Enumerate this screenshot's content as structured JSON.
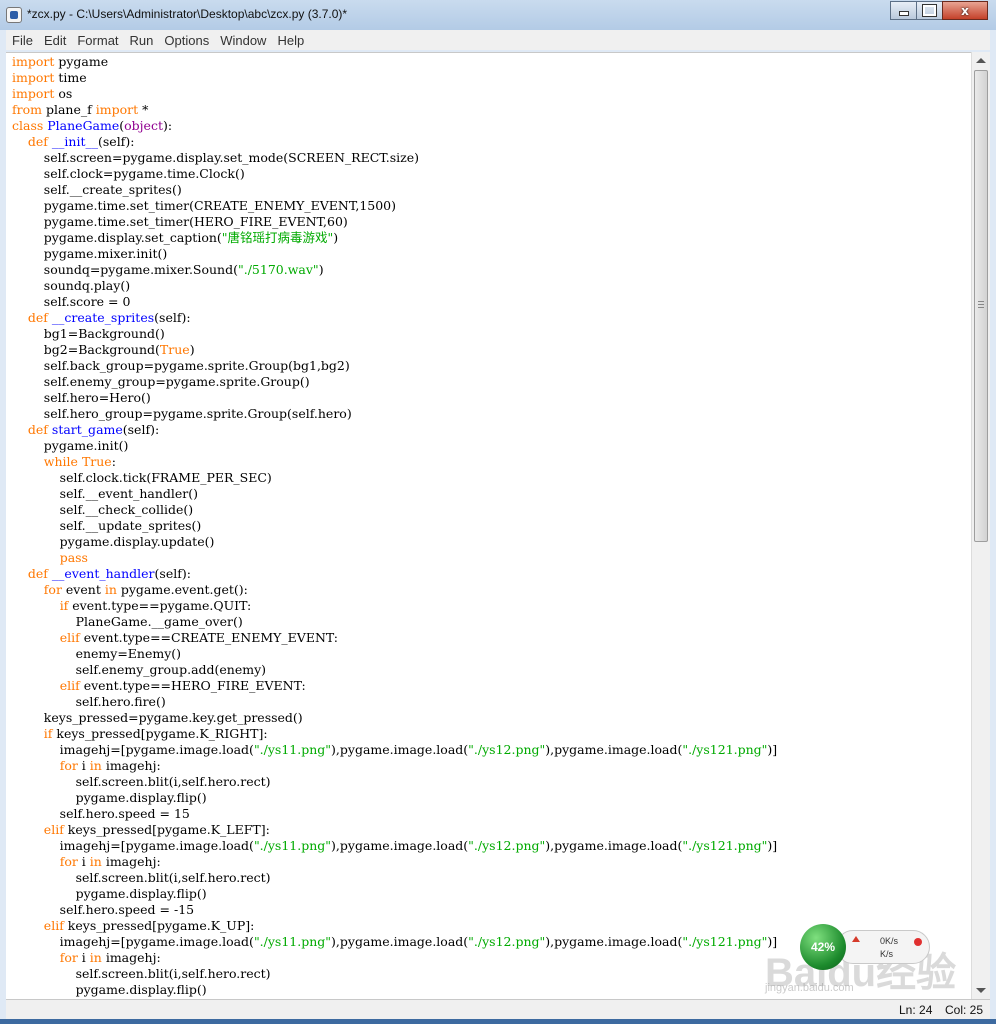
{
  "window": {
    "title": "*zcx.py - C:\\Users\\Administrator\\Desktop\\abc\\zcx.py (3.7.0)*",
    "controls": {
      "minimize": "minimize",
      "maximize": "maximize",
      "close": "x"
    }
  },
  "menu": [
    "File",
    "Edit",
    "Format",
    "Run",
    "Options",
    "Window",
    "Help"
  ],
  "code_lines": [
    [
      [
        "k",
        "import"
      ],
      [
        "n",
        " pygame"
      ]
    ],
    [
      [
        "k",
        "import"
      ],
      [
        "n",
        " time"
      ]
    ],
    [
      [
        "k",
        "import"
      ],
      [
        "n",
        " os"
      ]
    ],
    [
      [
        "k",
        "from"
      ],
      [
        "n",
        " plane_f "
      ],
      [
        "k",
        "import"
      ],
      [
        "n",
        " *"
      ]
    ],
    [
      [
        "k",
        "class"
      ],
      [
        "n",
        " "
      ],
      [
        "d",
        "PlaneGame"
      ],
      [
        "n",
        "("
      ],
      [
        "b",
        "object"
      ],
      [
        "n",
        "):"
      ]
    ],
    [
      [
        "n",
        "    "
      ],
      [
        "k",
        "def"
      ],
      [
        "n",
        " "
      ],
      [
        "d",
        "__init__"
      ],
      [
        "n",
        "(self):"
      ]
    ],
    [
      [
        "n",
        "        self.screen=pygame.display.set_mode(SCREEN_RECT.size)"
      ]
    ],
    [
      [
        "n",
        "        self.clock=pygame.time.Clock()"
      ]
    ],
    [
      [
        "n",
        "        self.__create_sprites()"
      ]
    ],
    [
      [
        "n",
        "        pygame.time.set_timer(CREATE_ENEMY_EVENT,1500)"
      ]
    ],
    [
      [
        "n",
        "        pygame.time.set_timer(HERO_FIRE_EVENT,60)"
      ]
    ],
    [
      [
        "n",
        "        pygame.display.set_caption("
      ],
      [
        "s",
        "\"唐铭瑶打病毒游戏\""
      ],
      [
        "n",
        ")"
      ]
    ],
    [
      [
        "n",
        "        pygame.mixer.init()"
      ]
    ],
    [
      [
        "n",
        "        soundq=pygame.mixer.Sound("
      ],
      [
        "s",
        "\"./5170.wav\""
      ],
      [
        "n",
        ")"
      ]
    ],
    [
      [
        "n",
        "        soundq.play()"
      ]
    ],
    [
      [
        "n",
        "        self.score = 0"
      ]
    ],
    [
      [
        "n",
        "    "
      ],
      [
        "k",
        "def"
      ],
      [
        "n",
        " "
      ],
      [
        "d",
        "__create_sprites"
      ],
      [
        "n",
        "(self):"
      ]
    ],
    [
      [
        "n",
        "        bg1=Background()"
      ]
    ],
    [
      [
        "n",
        "        bg2=Background("
      ],
      [
        "k",
        "True"
      ],
      [
        "n",
        ")"
      ]
    ],
    [
      [
        "n",
        "        self.back_group=pygame.sprite.Group(bg1,bg2)"
      ]
    ],
    [
      [
        "n",
        "        self.enemy_group=pygame.sprite.Group()"
      ]
    ],
    [
      [
        "n",
        "        self.hero=Hero()"
      ]
    ],
    [
      [
        "n",
        "        self.hero_group=pygame.sprite.Group(self.hero)"
      ]
    ],
    [
      [
        "n",
        "    "
      ],
      [
        "k",
        "def"
      ],
      [
        "n",
        " "
      ],
      [
        "d",
        "start_game"
      ],
      [
        "n",
        "(self):"
      ]
    ],
    [
      [
        "n",
        "        pygame.init()"
      ]
    ],
    [
      [
        "n",
        "        "
      ],
      [
        "k",
        "while"
      ],
      [
        "n",
        " "
      ],
      [
        "k",
        "True"
      ],
      [
        "n",
        ":"
      ]
    ],
    [
      [
        "n",
        "            self.clock.tick(FRAME_PER_SEC)"
      ]
    ],
    [
      [
        "n",
        "            self.__event_handler()"
      ]
    ],
    [
      [
        "n",
        "            self.__check_collide()"
      ]
    ],
    [
      [
        "n",
        "            self.__update_sprites()"
      ]
    ],
    [
      [
        "n",
        "            pygame.display.update()"
      ]
    ],
    [
      [
        "n",
        "            "
      ],
      [
        "k",
        "pass"
      ]
    ],
    [
      [
        "n",
        "    "
      ],
      [
        "k",
        "def"
      ],
      [
        "n",
        " "
      ],
      [
        "d",
        "__event_handler"
      ],
      [
        "n",
        "(self):"
      ]
    ],
    [
      [
        "n",
        "        "
      ],
      [
        "k",
        "for"
      ],
      [
        "n",
        " event "
      ],
      [
        "k",
        "in"
      ],
      [
        "n",
        " pygame.event.get():"
      ]
    ],
    [
      [
        "n",
        "            "
      ],
      [
        "k",
        "if"
      ],
      [
        "n",
        " event.type==pygame.QUIT:"
      ]
    ],
    [
      [
        "n",
        "                PlaneGame.__game_over()"
      ]
    ],
    [
      [
        "n",
        "            "
      ],
      [
        "k",
        "elif"
      ],
      [
        "n",
        " event.type==CREATE_ENEMY_EVENT:"
      ]
    ],
    [
      [
        "n",
        "                enemy=Enemy()"
      ]
    ],
    [
      [
        "n",
        "                self.enemy_group.add(enemy)"
      ]
    ],
    [
      [
        "n",
        "            "
      ],
      [
        "k",
        "elif"
      ],
      [
        "n",
        " event.type==HERO_FIRE_EVENT:"
      ]
    ],
    [
      [
        "n",
        "                self.hero.fire()"
      ]
    ],
    [
      [
        "n",
        "        keys_pressed=pygame.key.get_pressed()"
      ]
    ],
    [
      [
        "n",
        "        "
      ],
      [
        "k",
        "if"
      ],
      [
        "n",
        " keys_pressed[pygame.K_RIGHT]:"
      ]
    ],
    [
      [
        "n",
        "            imagehj=[pygame.image.load("
      ],
      [
        "s",
        "\"./ys11.png\""
      ],
      [
        "n",
        "),pygame.image.load("
      ],
      [
        "s",
        "\"./ys12.png\""
      ],
      [
        "n",
        "),pygame.image.load("
      ],
      [
        "s",
        "\"./ys121.png\""
      ],
      [
        "n",
        ")]"
      ]
    ],
    [
      [
        "n",
        "            "
      ],
      [
        "k",
        "for"
      ],
      [
        "n",
        " i "
      ],
      [
        "k",
        "in"
      ],
      [
        "n",
        " imagehj:"
      ]
    ],
    [
      [
        "n",
        "                self.screen.blit(i,self.hero.rect)"
      ]
    ],
    [
      [
        "n",
        "                pygame.display.flip()"
      ]
    ],
    [
      [
        "n",
        "            self.hero.speed = 15"
      ]
    ],
    [
      [
        "n",
        "        "
      ],
      [
        "k",
        "elif"
      ],
      [
        "n",
        " keys_pressed[pygame.K_LEFT]:"
      ]
    ],
    [
      [
        "n",
        "            imagehj=[pygame.image.load("
      ],
      [
        "s",
        "\"./ys11.png\""
      ],
      [
        "n",
        "),pygame.image.load("
      ],
      [
        "s",
        "\"./ys12.png\""
      ],
      [
        "n",
        "),pygame.image.load("
      ],
      [
        "s",
        "\"./ys121.png\""
      ],
      [
        "n",
        ")]"
      ]
    ],
    [
      [
        "n",
        "            "
      ],
      [
        "k",
        "for"
      ],
      [
        "n",
        " i "
      ],
      [
        "k",
        "in"
      ],
      [
        "n",
        " imagehj:"
      ]
    ],
    [
      [
        "n",
        "                self.screen.blit(i,self.hero.rect)"
      ]
    ],
    [
      [
        "n",
        "                pygame.display.flip()"
      ]
    ],
    [
      [
        "n",
        "            self.hero.speed = -15"
      ]
    ],
    [
      [
        "n",
        "        "
      ],
      [
        "k",
        "elif"
      ],
      [
        "n",
        " keys_pressed[pygame.K_UP]:"
      ]
    ],
    [
      [
        "n",
        "            imagehj=[pygame.image.load("
      ],
      [
        "s",
        "\"./ys11.png\""
      ],
      [
        "n",
        "),pygame.image.load("
      ],
      [
        "s",
        "\"./ys12.png\""
      ],
      [
        "n",
        "),pygame.image.load("
      ],
      [
        "s",
        "\"./ys121.png\""
      ],
      [
        "n",
        ")]"
      ]
    ],
    [
      [
        "n",
        "            "
      ],
      [
        "k",
        "for"
      ],
      [
        "n",
        " i "
      ],
      [
        "k",
        "in"
      ],
      [
        "n",
        " imagehj:"
      ]
    ],
    [
      [
        "n",
        "                self.screen.blit(i,self.hero.rect)"
      ]
    ],
    [
      [
        "n",
        "                pygame.display.flip()"
      ]
    ]
  ],
  "status": {
    "line": "Ln: 24",
    "col": "Col: 25"
  },
  "net_widget": {
    "percent": "42%",
    "up_speed": "0K/s",
    "down_speed": "K/s"
  },
  "watermark": {
    "text": "Baidu经验",
    "url": "jingyan.baidu.com"
  },
  "colors": {
    "keyword": "#ff7700",
    "definition": "#0000ff",
    "string": "#00aa00",
    "builtin": "#900090"
  },
  "icons": {
    "app": "python-idle-icon",
    "scroll_up": "arrow-up-icon",
    "scroll_down": "arrow-down-icon"
  }
}
